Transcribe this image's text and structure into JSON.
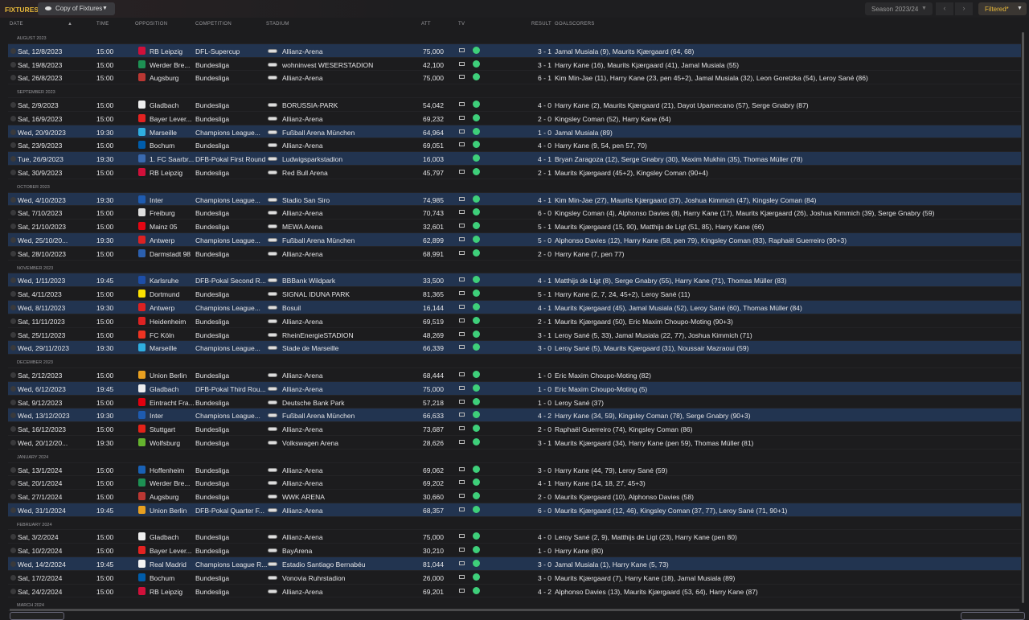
{
  "header": {
    "title": "FIXTURES",
    "view": "Copy of Fixtures",
    "season": "Season 2023/24",
    "filter": "Filtered*",
    "prev": "‹",
    "next": "›"
  },
  "columns": [
    "DATE",
    "TIME",
    "OPPOSITION",
    "COMPETITION",
    "STADIUM",
    "ATT",
    "TV",
    "RESULT",
    "GOALSCORERS"
  ],
  "sort_indicator": "▲",
  "colors": {
    "highlight": "#223450",
    "accent": "#e8b93a",
    "status_dot": "#3ecf7a"
  },
  "rows": [
    {
      "month": "AUGUST 2023"
    },
    {
      "date": "Sat, 12/8/2023",
      "time": "15:00",
      "opp": "RB Leipzig",
      "comp": "DFL-Supercup",
      "stadium": "Allianz-Arena",
      "att": "75,000",
      "tv": true,
      "result": "3 - 1",
      "scorers": "Jamal Musiala (9), Maurits Kjærgaard (64, 68)",
      "hl": true,
      "badge": "#d0103a"
    },
    {
      "date": "Sat, 19/8/2023",
      "time": "15:00",
      "opp": "Werder Bre...",
      "comp": "Bundesliga",
      "stadium": "wohninvest WESERSTADION",
      "att": "42,100",
      "tv": true,
      "result": "3 - 1",
      "scorers": "Harry Kane (16), Maurits Kjærgaard (41), Jamal Musiala (55)",
      "badge": "#1d9053"
    },
    {
      "date": "Sat, 26/8/2023",
      "time": "15:00",
      "opp": "Augsburg",
      "comp": "Bundesliga",
      "stadium": "Allianz-Arena",
      "att": "75,000",
      "tv": true,
      "result": "6 - 1",
      "scorers": "Kim Min-Jae (11), Harry Kane (23, pen 45+2), Jamal Musiala (32), Leon Goretzka (54), Leroy Sané (86)",
      "badge": "#ba3733"
    },
    {
      "month": "SEPTEMBER 2023"
    },
    {
      "date": "Sat, 2/9/2023",
      "time": "15:00",
      "opp": "Gladbach",
      "comp": "Bundesliga",
      "stadium": "BORUSSIA-PARK",
      "att": "54,042",
      "tv": true,
      "result": "4 - 0",
      "scorers": "Harry Kane (2), Maurits Kjærgaard (21), Dayot Upamecano (57), Serge Gnabry (87)",
      "badge": "#eeeeee"
    },
    {
      "date": "Sat, 16/9/2023",
      "time": "15:00",
      "opp": "Bayer Lever...",
      "comp": "Bundesliga",
      "stadium": "Allianz-Arena",
      "att": "69,232",
      "tv": true,
      "result": "2 - 0",
      "scorers": "Kingsley Coman (52), Harry Kane (64)",
      "badge": "#e32221"
    },
    {
      "date": "Wed, 20/9/2023",
      "time": "19:30",
      "opp": "Marseille",
      "comp": "Champions League...",
      "stadium": "Fußball Arena München",
      "att": "64,964",
      "tv": true,
      "result": "1 - 0",
      "scorers": "Jamal Musiala (89)",
      "hl": true,
      "badge": "#2faee0"
    },
    {
      "date": "Sat, 23/9/2023",
      "time": "15:00",
      "opp": "Bochum",
      "comp": "Bundesliga",
      "stadium": "Allianz-Arena",
      "att": "69,051",
      "tv": true,
      "result": "4 - 0",
      "scorers": "Harry Kane (9, 54, pen 57, 70)",
      "badge": "#005ca9"
    },
    {
      "date": "Tue, 26/9/2023",
      "time": "19:30",
      "opp": "1. FC Saarbr...",
      "comp": "DFB-Pokal First Round",
      "stadium": "Ludwigsparkstadion",
      "att": "16,003",
      "tv": false,
      "result": "4 - 1",
      "scorers": "Bryan Zaragoza (12), Serge Gnabry (30), Maxim Mukhin (35), Thomas Müller (78)",
      "hl": true,
      "badge": "#3a6ab0"
    },
    {
      "date": "Sat, 30/9/2023",
      "time": "15:00",
      "opp": "RB Leipzig",
      "comp": "Bundesliga",
      "stadium": "Red Bull Arena",
      "att": "45,797",
      "tv": true,
      "result": "2 - 1",
      "scorers": "Maurits Kjærgaard (45+2), Kingsley Coman (90+4)",
      "badge": "#d0103a"
    },
    {
      "month": "OCTOBER 2023"
    },
    {
      "date": "Wed, 4/10/2023",
      "time": "19:30",
      "opp": "Inter",
      "comp": "Champions League...",
      "stadium": "Stadio San Siro",
      "att": "74,985",
      "tv": true,
      "result": "4 - 1",
      "scorers": "Kim Min-Jae (27), Maurits Kjærgaard (37), Joshua Kimmich (47), Kingsley Coman (84)",
      "hl": true,
      "badge": "#1e5bb0"
    },
    {
      "date": "Sat, 7/10/2023",
      "time": "15:00",
      "opp": "Freiburg",
      "comp": "Bundesliga",
      "stadium": "Allianz-Arena",
      "att": "70,743",
      "tv": true,
      "result": "6 - 0",
      "scorers": "Kingsley Coman (4), Alphonso Davies (8), Harry Kane (17), Maurits Kjærgaard (26), Joshua Kimmich (39), Serge Gnabry (59)",
      "badge": "#dddddd"
    },
    {
      "date": "Sat, 21/10/2023",
      "time": "15:00",
      "opp": "Mainz 05",
      "comp": "Bundesliga",
      "stadium": "MEWA Arena",
      "att": "32,601",
      "tv": true,
      "result": "5 - 1",
      "scorers": "Maurits Kjærgaard (15, 90), Matthijs de Ligt (51, 85), Harry Kane (66)",
      "badge": "#e30613"
    },
    {
      "date": "Wed, 25/10/20...",
      "time": "19:30",
      "opp": "Antwerp",
      "comp": "Champions League...",
      "stadium": "Fußball Arena München",
      "att": "62,899",
      "tv": true,
      "result": "5 - 0",
      "scorers": "Alphonso Davies (12), Harry Kane (58, pen 79), Kingsley Coman (83), Raphaël Guerreiro (90+3)",
      "hl": true,
      "badge": "#d22"
    },
    {
      "date": "Sat, 28/10/2023",
      "time": "15:00",
      "opp": "Darmstadt 98",
      "comp": "Bundesliga",
      "stadium": "Allianz-Arena",
      "att": "68,991",
      "tv": true,
      "result": "2 - 0",
      "scorers": "Harry Kane (7, pen 77)",
      "badge": "#2b5fae"
    },
    {
      "month": "NOVEMBER 2023"
    },
    {
      "date": "Wed, 1/11/2023",
      "time": "19:45",
      "opp": "Karlsruhe",
      "comp": "DFB-Pokal Second R...",
      "stadium": "BBBank Wildpark",
      "att": "33,500",
      "tv": true,
      "result": "4 - 1",
      "scorers": "Matthijs de Ligt (8), Serge Gnabry (55), Harry Kane (71), Thomas Müller (83)",
      "hl": true,
      "badge": "#1d4ea8"
    },
    {
      "date": "Sat, 4/11/2023",
      "time": "15:00",
      "opp": "Dortmund",
      "comp": "Bundesliga",
      "stadium": "SIGNAL IDUNA PARK",
      "att": "81,365",
      "tv": true,
      "result": "5 - 1",
      "scorers": "Harry Kane (2, 7, 24, 45+2), Leroy Sané (11)",
      "badge": "#fde100"
    },
    {
      "date": "Wed, 8/11/2023",
      "time": "19:30",
      "opp": "Antwerp",
      "comp": "Champions League...",
      "stadium": "Bosuil",
      "att": "16,144",
      "tv": true,
      "result": "4 - 1",
      "scorers": "Maurits Kjærgaard (45), Jamal Musiala (52), Leroy Sané (60), Thomas Müller (84)",
      "hl": true,
      "badge": "#d22"
    },
    {
      "date": "Sat, 11/11/2023",
      "time": "15:00",
      "opp": "Heidenheim",
      "comp": "Bundesliga",
      "stadium": "Allianz-Arena",
      "att": "69,519",
      "tv": true,
      "result": "2 - 1",
      "scorers": "Maurits Kjærgaard (50), Eric Maxim Choupo-Moting (90+3)",
      "badge": "#d22"
    },
    {
      "date": "Sat, 25/11/2023",
      "time": "15:00",
      "opp": "FC Köln",
      "comp": "Bundesliga",
      "stadium": "RheinEnergieSTADION",
      "att": "48,269",
      "tv": true,
      "result": "3 - 1",
      "scorers": "Leroy Sané (5, 33), Jamal Musiala (22, 77), Joshua Kimmich (71)",
      "badge": "#e32"
    },
    {
      "date": "Wed, 29/11/2023",
      "time": "19:30",
      "opp": "Marseille",
      "comp": "Champions League...",
      "stadium": "Stade de Marseille",
      "att": "66,339",
      "tv": true,
      "result": "3 - 0",
      "scorers": "Leroy Sané (5), Maurits Kjærgaard (31), Noussair Mazraoui (59)",
      "hl": true,
      "badge": "#2faee0"
    },
    {
      "month": "DECEMBER 2023"
    },
    {
      "date": "Sat, 2/12/2023",
      "time": "15:00",
      "opp": "Union Berlin",
      "comp": "Bundesliga",
      "stadium": "Allianz-Arena",
      "att": "68,444",
      "tv": true,
      "result": "1 - 0",
      "scorers": "Eric Maxim Choupo-Moting (82)",
      "badge": "#e8a020"
    },
    {
      "date": "Wed, 6/12/2023",
      "time": "19:45",
      "opp": "Gladbach",
      "comp": "DFB-Pokal Third Rou...",
      "stadium": "Allianz-Arena",
      "att": "75,000",
      "tv": true,
      "result": "1 - 0",
      "scorers": "Eric Maxim Choupo-Moting (5)",
      "hl": true,
      "badge": "#eeeeee"
    },
    {
      "date": "Sat, 9/12/2023",
      "time": "15:00",
      "opp": "Eintracht Fra...",
      "comp": "Bundesliga",
      "stadium": "Deutsche Bank Park",
      "att": "57,218",
      "tv": true,
      "result": "1 - 0",
      "scorers": "Leroy Sané (37)",
      "badge": "#e1000f"
    },
    {
      "date": "Wed, 13/12/2023",
      "time": "19:30",
      "opp": "Inter",
      "comp": "Champions League...",
      "stadium": "Fußball Arena München",
      "att": "66,633",
      "tv": true,
      "result": "4 - 2",
      "scorers": "Harry Kane (34, 59), Kingsley Coman (78), Serge Gnabry (90+3)",
      "hl": true,
      "badge": "#1e5bb0"
    },
    {
      "date": "Sat, 16/12/2023",
      "time": "15:00",
      "opp": "Stuttgart",
      "comp": "Bundesliga",
      "stadium": "Allianz-Arena",
      "att": "73,687",
      "tv": true,
      "result": "2 - 0",
      "scorers": "Raphaël Guerreiro (74), Kingsley Coman (86)",
      "badge": "#e32219"
    },
    {
      "date": "Wed, 20/12/20...",
      "time": "19:30",
      "opp": "Wolfsburg",
      "comp": "Bundesliga",
      "stadium": "Volkswagen Arena",
      "att": "28,626",
      "tv": true,
      "result": "3 - 1",
      "scorers": "Maurits Kjærgaard (34), Harry Kane (pen 59), Thomas Müller (81)",
      "badge": "#65b32e"
    },
    {
      "month": "JANUARY 2024"
    },
    {
      "date": "Sat, 13/1/2024",
      "time": "15:00",
      "opp": "Hoffenheim",
      "comp": "Bundesliga",
      "stadium": "Allianz-Arena",
      "att": "69,062",
      "tv": true,
      "result": "3 - 0",
      "scorers": "Harry Kane (44, 79), Leroy Sané (59)",
      "badge": "#1961b5"
    },
    {
      "date": "Sat, 20/1/2024",
      "time": "15:00",
      "opp": "Werder Bre...",
      "comp": "Bundesliga",
      "stadium": "Allianz-Arena",
      "att": "69,202",
      "tv": true,
      "result": "4 - 1",
      "scorers": "Harry Kane (14, 18, 27, 45+3)",
      "badge": "#1d9053"
    },
    {
      "date": "Sat, 27/1/2024",
      "time": "15:00",
      "opp": "Augsburg",
      "comp": "Bundesliga",
      "stadium": "WWK ARENA",
      "att": "30,660",
      "tv": true,
      "result": "2 - 0",
      "scorers": "Maurits Kjærgaard (10), Alphonso Davies (58)",
      "badge": "#ba3733"
    },
    {
      "date": "Wed, 31/1/2024",
      "time": "19:45",
      "opp": "Union Berlin",
      "comp": "DFB-Pokal Quarter F...",
      "stadium": "Allianz-Arena",
      "att": "68,357",
      "tv": true,
      "result": "6 - 0",
      "scorers": "Maurits Kjærgaard (12, 46), Kingsley Coman (37, 77), Leroy Sané (71, 90+1)",
      "hl": true,
      "badge": "#e8a020"
    },
    {
      "month": "FEBRUARY 2024"
    },
    {
      "date": "Sat, 3/2/2024",
      "time": "15:00",
      "opp": "Gladbach",
      "comp": "Bundesliga",
      "stadium": "Allianz-Arena",
      "att": "75,000",
      "tv": true,
      "result": "4 - 0",
      "scorers": "Leroy Sané (2, 9), Matthijs de Ligt (23), Harry Kane (pen 80)",
      "badge": "#eeeeee"
    },
    {
      "date": "Sat, 10/2/2024",
      "time": "15:00",
      "opp": "Bayer Lever...",
      "comp": "Bundesliga",
      "stadium": "BayArena",
      "att": "30,210",
      "tv": true,
      "result": "1 - 0",
      "scorers": "Harry Kane (80)",
      "badge": "#e32221"
    },
    {
      "date": "Wed, 14/2/2024",
      "time": "19:45",
      "opp": "Real Madrid",
      "comp": "Champions League R...",
      "stadium": "Estadio Santiago Bernabéu",
      "att": "81,044",
      "tv": true,
      "result": "3 - 0",
      "scorers": "Jamal Musiala (1), Harry Kane (5, 73)",
      "hl": true,
      "badge": "#f4f4f4"
    },
    {
      "date": "Sat, 17/2/2024",
      "time": "15:00",
      "opp": "Bochum",
      "comp": "Bundesliga",
      "stadium": "Vonovia Ruhrstadion",
      "att": "26,000",
      "tv": true,
      "result": "3 - 0",
      "scorers": "Maurits Kjærgaard (7), Harry Kane (18), Jamal Musiala (89)",
      "badge": "#005ca9"
    },
    {
      "date": "Sat, 24/2/2024",
      "time": "15:00",
      "opp": "RB Leipzig",
      "comp": "Bundesliga",
      "stadium": "Allianz-Arena",
      "att": "69,201",
      "tv": true,
      "result": "4 - 2",
      "scorers": "Alphonso Davies (13), Maurits Kjærgaard (53, 64), Harry Kane (87)",
      "badge": "#d0103a"
    },
    {
      "month": "MARCH 2024"
    }
  ]
}
